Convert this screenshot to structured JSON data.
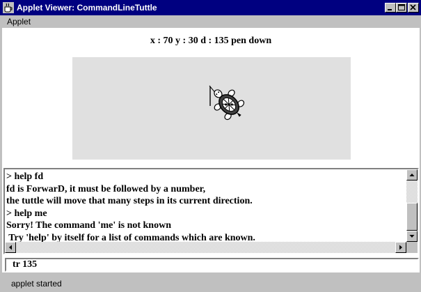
{
  "window": {
    "title": "Applet Viewer: CommandLineTuttle",
    "app_icon": "coffee-cup-icon",
    "controls": [
      "minimize-icon",
      "maximize-icon",
      "close-icon"
    ]
  },
  "menubar": {
    "items": [
      {
        "label": "Applet"
      }
    ]
  },
  "turtle_status": {
    "text": "x : 70 y : 30 d : 135 pen down"
  },
  "canvas": {
    "background": "#e0e0e0",
    "sprite": "turtle-icon"
  },
  "output": {
    "lines": [
      "> help fd",
      "fd is ForwarD, it must be followed by a number,",
      "the tuttle will move that many steps in its current direction.",
      "> help me",
      "Sorry! The command 'me' is not known",
      " Try 'help' by itself for a list of commands which are known."
    ]
  },
  "command_input": {
    "value": "tr 135"
  },
  "statusbar": {
    "text": "applet started"
  },
  "colors": {
    "titlebar": "#000080",
    "chrome": "#c0c0c0",
    "canvas": "#e0e0e0"
  }
}
